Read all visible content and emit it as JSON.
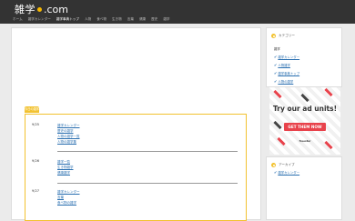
{
  "header": {
    "logo_text": "雑学",
    "logo_domain": ".com",
    "nav": [
      {
        "label": "ホーム",
        "active": false
      },
      {
        "label": "雑学カレンダー",
        "active": false
      },
      {
        "label": "雑学事典トップ",
        "active": true
      },
      {
        "label": "人物",
        "active": false
      },
      {
        "label": "食べ物",
        "active": false
      },
      {
        "label": "生き物",
        "active": false
      },
      {
        "label": "言葉",
        "active": false
      },
      {
        "label": "健康",
        "active": false
      },
      {
        "label": "歴史",
        "active": false
      },
      {
        "label": "雑学",
        "active": false
      }
    ]
  },
  "calendar": {
    "tab_label": "今日の雑学",
    "rows": [
      {
        "date": "9/25",
        "links": [
          "雑学カレンダー",
          "歴史の雑学",
          "人物の雑学一覧",
          "人物の雑学集"
        ]
      },
      {
        "date": "9/26",
        "links": [
          "雑学一覧",
          "生き物雑学",
          "健康雑学"
        ]
      },
      {
        "date": "9/27",
        "links": [
          "雑学カレンダー",
          "言葉",
          "食べ物の雑学"
        ]
      }
    ]
  },
  "sidebar": {
    "widget1": {
      "title": "カテゴリー",
      "subtitle": "雑学",
      "items": [
        "雑学カレンダー",
        "人物雑学",
        "雑学事典トップ",
        "人物の雑学"
      ]
    },
    "ad": {
      "headline": "Try our ad units!",
      "button": "GET THEM NOW",
      "brand": "freestar"
    },
    "widget2": {
      "title": "アーカイブ",
      "items": [
        "雑学カレンダー"
      ]
    }
  }
}
